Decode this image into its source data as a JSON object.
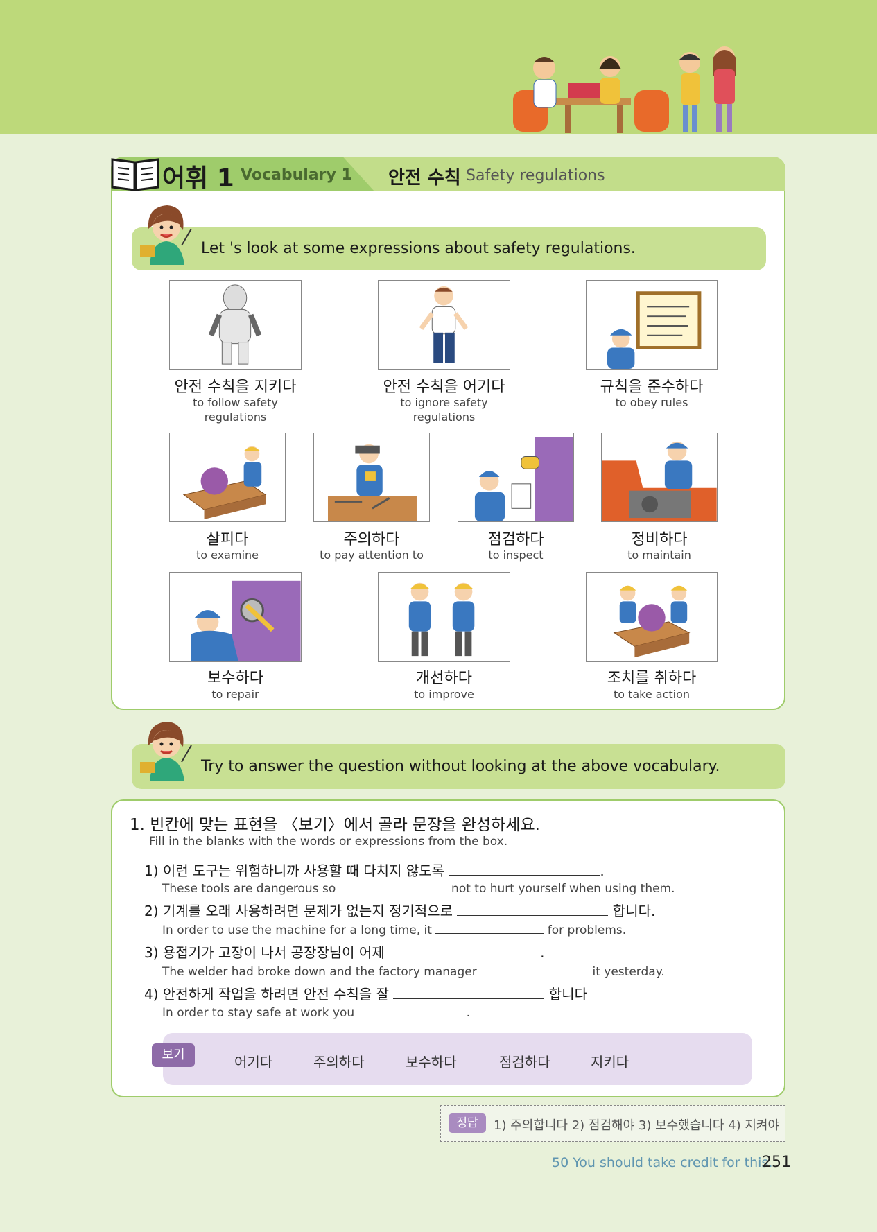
{
  "header": {
    "unit_label": "어휘 1",
    "unit_sub": "Vocabulary 1",
    "topic_ko": "안전 수칙",
    "topic_en": "Safety regulations"
  },
  "bubble1": "Let 's look at some expressions about safety regulations.",
  "vocab": [
    {
      "ko": "안전 수칙을 지키다",
      "en": "to follow safety regulations",
      "icon": "protective-suit-worker"
    },
    {
      "ko": "안전 수칙을 어기다",
      "en": "to ignore safety regulations",
      "icon": "careless-worker"
    },
    {
      "ko": "규칙을 준수하다",
      "en": "to obey rules",
      "icon": "rules-board"
    },
    {
      "ko": "살피다",
      "en": "to examine",
      "icon": "worker-examining-saw"
    },
    {
      "ko": "주의하다",
      "en": "to pay attention to",
      "icon": "welder-with-mask"
    },
    {
      "ko": "점검하다",
      "en": "to inspect",
      "icon": "worker-inspecting-meter"
    },
    {
      "ko": "정비하다",
      "en": "to maintain",
      "icon": "worker-maintaining-machine"
    },
    {
      "ko": "보수하다",
      "en": "to repair",
      "icon": "worker-with-wrench"
    },
    {
      "ko": "개선하다",
      "en": "to improve",
      "icon": "two-workers"
    },
    {
      "ko": "조치를 취하다",
      "en": "to take action",
      "icon": "workers-at-saw"
    }
  ],
  "bubble2": "Try to answer the question without looking at the above vocabulary.",
  "exercise": {
    "title": "1. 빈칸에 맞는 표현을 〈보기〉에서 골라 문장을 완성하세요.",
    "subtitle": "Fill in the blanks with the words or expressions from the box.",
    "questions": [
      {
        "ko_a": "1) 이런 도구는 위험하니까 사용할 때 다치지 않도록",
        "ko_b": ".",
        "en_a": "These tools are dangerous so",
        "en_b": "not to hurt yourself when using them."
      },
      {
        "ko_a": "2) 기계를 오래 사용하려면 문제가 없는지 정기적으로",
        "ko_b": "합니다.",
        "en_a": "In order to use the machine for a long time, it",
        "en_b": "for problems."
      },
      {
        "ko_a": "3) 용접기가 고장이 나서 공장장님이 어제",
        "ko_b": ".",
        "en_a": "The welder had broke down and the factory manager",
        "en_b": "it yesterday."
      },
      {
        "ko_a": "4) 안전하게 작업을 하려면 안전 수칙을 잘",
        "ko_b": "합니다",
        "en_a": "In order to stay safe at work you",
        "en_b": "."
      }
    ],
    "wordbox_label": "보기",
    "words": [
      "어기다",
      "주의하다",
      "보수하다",
      "점검하다",
      "지키다"
    ]
  },
  "answer": {
    "label": "정답",
    "text": "1) 주의합니다  2) 점검해야  3) 보수했습니다  4) 지켜야"
  },
  "footer": {
    "text": "50 You should take credit for this.",
    "page": "251"
  },
  "colors": {
    "header_green": "#bdd97a",
    "accent_green": "#9fcc6b",
    "purple": "#8e6ba8"
  }
}
